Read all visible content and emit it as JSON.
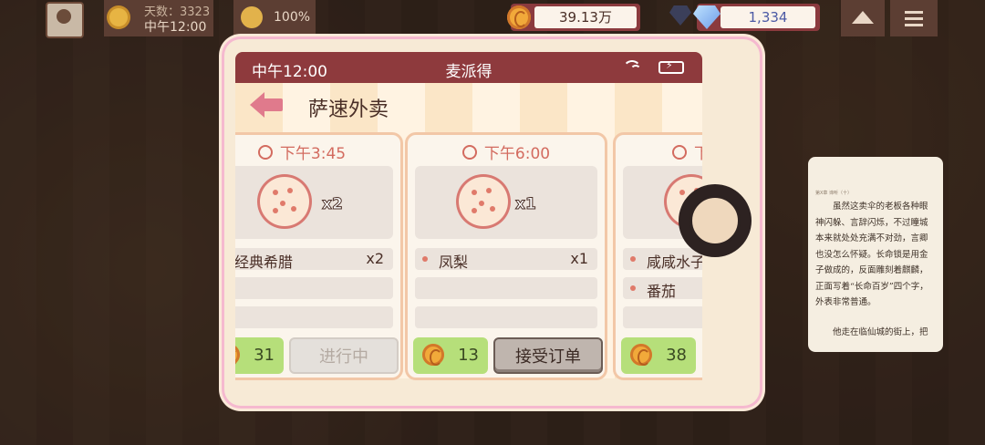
{
  "hud": {
    "day_label": "天数：3323",
    "time_label": "中午12:00",
    "mood": "100%",
    "coins": "39.13万",
    "gems": "1,334"
  },
  "phone": {
    "status_time": "中午12:00",
    "app_name": "麦派得",
    "page_title": "萨速外卖",
    "orders": [
      {
        "time": "下午3:45",
        "qty": "x2",
        "items": [
          {
            "name": "经典希腊",
            "count": "x2"
          }
        ],
        "reward": "31",
        "action": "进行中"
      },
      {
        "time": "下午6:00",
        "qty": "x1",
        "items": [
          {
            "name": "凤梨",
            "count": "x1"
          }
        ],
        "reward": "13",
        "action": "接受订单"
      },
      {
        "time": "下",
        "qty": "",
        "items": [
          {
            "name": "咸咸水子",
            "count": ""
          },
          {
            "name": "番茄",
            "count": ""
          }
        ],
        "reward": "38",
        "action": ""
      }
    ]
  },
  "reader": {
    "header": "第X章 谛听（十）",
    "para1": "虽然这卖伞的老板各种眼神闪躲、言辞闪烁，不过瞳城本来就处处充满不对劲，言卿也没怎么怀疑。长命锁是用金子做成的，反面雕刻着麒麟，正面写着“长命百岁”四个字，外表非常普通。",
    "para2": "他走在临仙城的街上，把"
  }
}
